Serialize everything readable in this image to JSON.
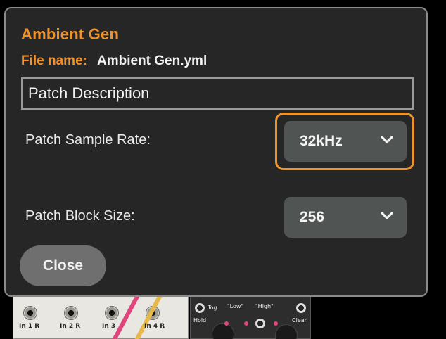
{
  "dialog": {
    "patch_name": "Ambient Gen",
    "file_name_label": "File name:",
    "file_name_value": "Ambient Gen.yml",
    "description_value": "Patch Description",
    "sample_rate": {
      "label": "Patch Sample Rate:",
      "selected": "32kHz"
    },
    "block_size": {
      "label": "Patch Block Size:",
      "selected": "256"
    },
    "close_label": "Close"
  },
  "background_modules": {
    "jack_labels": [
      "In 1 R",
      "In 2 R",
      "In 3",
      "In 4 R"
    ],
    "module_labels": [
      "Tog.",
      "\"Low\"",
      "\"High\"",
      "Hold",
      "Clear"
    ]
  },
  "colors": {
    "accent": "#f0922a",
    "dialog_bg": "#262626",
    "select_bg": "#505452",
    "close_bg": "#6f6f6f",
    "cable_pink": "#e0457b"
  },
  "icons": {
    "dropdown": "chevron-down-icon"
  }
}
